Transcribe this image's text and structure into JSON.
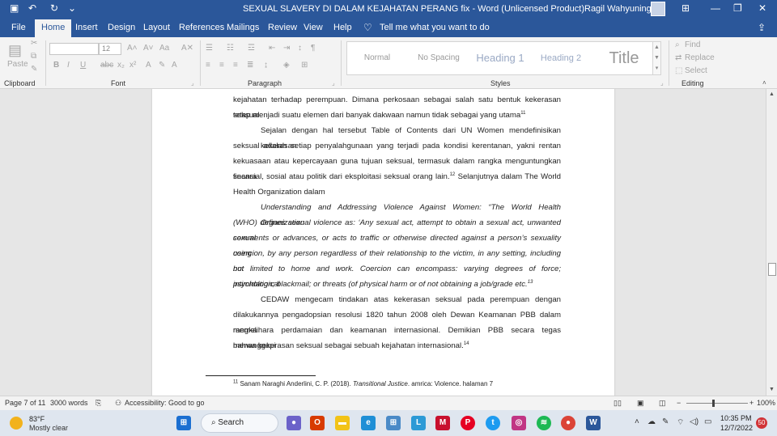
{
  "app": {
    "title": "SEXUAL SLAVERY DI DALAM KEJAHATAN PERANG fix  -  Word (Unlicensed Product)",
    "user_name": "Ragil Wahyuningsih"
  },
  "tabs": [
    "File",
    "Home",
    "Insert",
    "Design",
    "Layout",
    "References",
    "Mailings",
    "Review",
    "View",
    "Help"
  ],
  "active_tab": "Home",
  "tell_me": "Tell me what you want to do",
  "ribbon": {
    "clipboard": {
      "label": "Clipboard",
      "paste": "Paste"
    },
    "font": {
      "label": "Font",
      "font_size": "12"
    },
    "paragraph": {
      "label": "Paragraph"
    },
    "styles": {
      "label": "Styles",
      "items": [
        "Normal",
        "No Spacing",
        "Heading 1",
        "Heading 2",
        "Title"
      ]
    },
    "editing": {
      "label": "Editing",
      "find": "Find",
      "replace": "Replace",
      "select": "Select"
    }
  },
  "document": {
    "line_top_1": "kejahatan terhadap perempuan. Dimana perkosaan sebagai salah satu bentuk kekerasan seksual",
    "line_top_2": "tetap menjadi suatu elemen dari banyak dakwaan namun tidak sebagai yang utama",
    "sup_11": "11",
    "para2_lines": [
      "Sejalan dengan hal tersebut Table of Contents dari UN Women mendefinisikan kekerasan",
      "seksual adalah setiap penyalahgunaan yang terjadi pada kondisi kerentanan, yakni rentan",
      "kekuasaan atau kepercayaan guna tujuan seksual, termasuk dalam rangka menguntungkan secara",
      "finansial, sosial atau politik dari eksploitasi seksual orang lain.",
      "Health Organization dalam"
    ],
    "sup_12": "12",
    "para2_line4_tail": " Selanjutnya dalam The World",
    "quote_lines": [
      "Understanding and Addressing Violence Against Women: “The World Health Organization",
      "(WHO) defines sexual violence as: ‘Any sexual act, attempt to obtain a sexual act, unwanted sexual",
      "comments or advances, or acts to traffic or otherwise directed against a person’s sexuality using",
      "coercion, by any person regardless of their relationship to the victim, in any setting, including but",
      "not limited to home and work. Coercion can encompass: varying degrees of force; psychological",
      "intimidation; blackmail; or threats (of physical harm or of not obtaining a job/grade etc."
    ],
    "sup_13": "13",
    "para4_lines": [
      "CEDAW mengecam tindakan atas kekerasan seksual pada perempuan dengan",
      "dilakukannya pengadopsian resolusi 1820 tahun 2008 oleh Dewan Keamanan PBB dalam rangka",
      "memelihara perdamaian dan keamanan internasional. Demikian PBB secara tegas menanggapi",
      "bahwa kekerasan seksual sebagai sebuah kejahatan internasional."
    ],
    "sup_14": "14",
    "footnote_num": "11",
    "footnote_text_a": "Sanam Naraghi Anderlini, C. P. (2018). ",
    "footnote_text_b": "Transitional Justice",
    "footnote_text_c": ". amrica: Violence. halaman 7"
  },
  "status": {
    "page": "Page 7 of 11",
    "words": "3000 words",
    "accessibility": "Accessibility: Good to go",
    "zoom": "100%"
  },
  "taskbar": {
    "weather_temp": "83°F",
    "weather_desc": "Mostly clear",
    "search": "Search",
    "time": "10:35 PM",
    "date": "12/7/2022",
    "notifications": "50"
  },
  "colors": {
    "brand": "#2b579a",
    "spell_error": "#d13438"
  }
}
